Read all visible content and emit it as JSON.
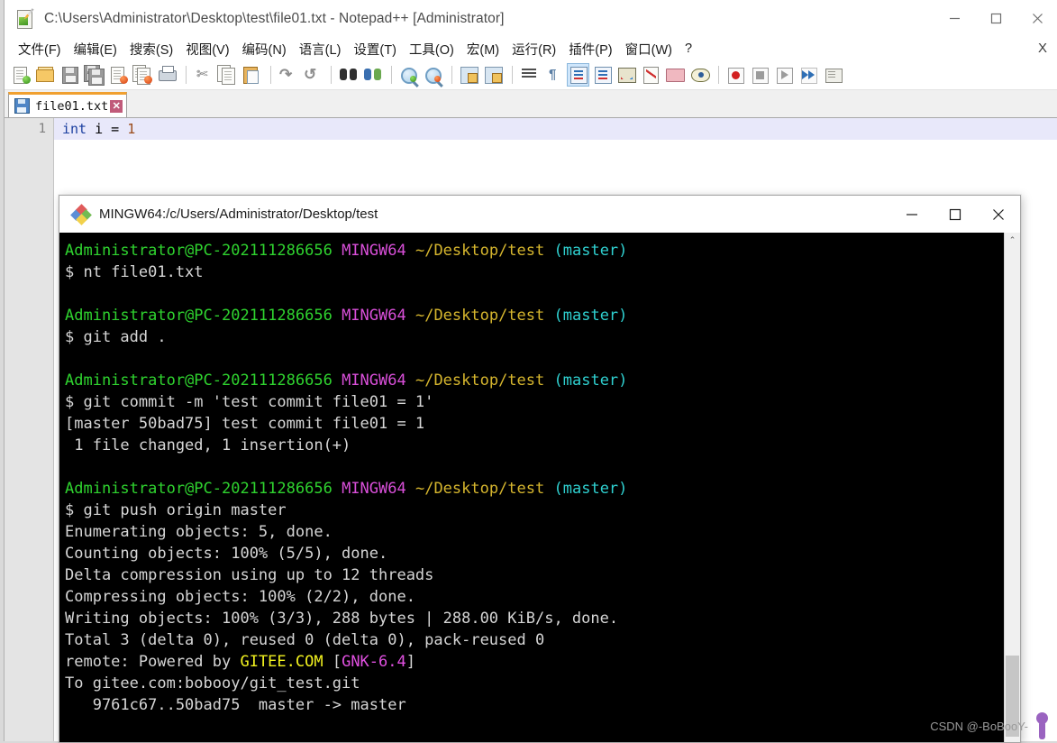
{
  "notepad": {
    "title": "C:\\Users\\Administrator\\Desktop\\test\\file01.txt - Notepad++ [Administrator]",
    "app_icon": "notepad-plus-plus-icon",
    "window_controls": {
      "minimize": "—",
      "maximize": "□",
      "close": "✕"
    },
    "menu": [
      "文件(F)",
      "编辑(E)",
      "搜索(S)",
      "视图(V)",
      "编码(N)",
      "语言(L)",
      "设置(T)",
      "工具(O)",
      "宏(M)",
      "运行(R)",
      "插件(P)",
      "窗口(W)",
      "?"
    ],
    "menu_close_label": "X",
    "toolbar": [
      {
        "name": "new-file-icon",
        "kind": "doc-new"
      },
      {
        "name": "open-file-icon",
        "kind": "folder-open"
      },
      {
        "name": "save-icon",
        "kind": "floppy"
      },
      {
        "name": "save-all-icon",
        "kind": "floppy-multi"
      },
      {
        "name": "close-file-icon",
        "kind": "doc-close"
      },
      {
        "name": "close-all-files-icon",
        "kind": "doc-multi-close"
      },
      {
        "name": "print-icon",
        "kind": "printer"
      },
      {
        "name": "separator",
        "kind": "sep"
      },
      {
        "name": "cut-icon",
        "kind": "scissors"
      },
      {
        "name": "copy-icon",
        "kind": "copy"
      },
      {
        "name": "paste-icon",
        "kind": "clipboard"
      },
      {
        "name": "separator",
        "kind": "sep"
      },
      {
        "name": "undo-icon",
        "kind": "undo"
      },
      {
        "name": "redo-icon",
        "kind": "redo"
      },
      {
        "name": "separator",
        "kind": "sep"
      },
      {
        "name": "find-icon",
        "kind": "binoculars"
      },
      {
        "name": "replace-icon",
        "kind": "replace"
      },
      {
        "name": "separator",
        "kind": "sep"
      },
      {
        "name": "zoom-in-icon",
        "kind": "magnifier-plus"
      },
      {
        "name": "zoom-out-icon",
        "kind": "magnifier-minus"
      },
      {
        "name": "separator",
        "kind": "sep"
      },
      {
        "name": "sync-vertical-scroll-icon",
        "kind": "lock-window"
      },
      {
        "name": "sync-horizontal-scroll-icon",
        "kind": "lock-window"
      },
      {
        "name": "separator",
        "kind": "sep"
      },
      {
        "name": "word-wrap-icon",
        "kind": "bars"
      },
      {
        "name": "show-all-characters-icon",
        "kind": "pilcrow"
      },
      {
        "name": "indent-guide-icon",
        "kind": "indent-guide",
        "selected": true
      },
      {
        "name": "user-defined-language-icon",
        "kind": "udl"
      },
      {
        "name": "document-map-icon",
        "kind": "map"
      },
      {
        "name": "function-list-icon",
        "kind": "function-list"
      },
      {
        "name": "folder-as-workspace-icon",
        "kind": "folder-pink"
      },
      {
        "name": "monitoring-icon",
        "kind": "eye"
      },
      {
        "name": "separator",
        "kind": "sep"
      },
      {
        "name": "start-record-macro-icon",
        "kind": "record"
      },
      {
        "name": "stop-record-macro-icon",
        "kind": "stop"
      },
      {
        "name": "playback-macro-icon",
        "kind": "play"
      },
      {
        "name": "run-macro-multiple-icon",
        "kind": "fast-forward"
      },
      {
        "name": "save-macro-icon",
        "kind": "save-macro"
      }
    ],
    "tab": {
      "label": "file01.txt",
      "icon": "saved-file-icon",
      "close_label": "✕"
    },
    "editor": {
      "line_number": "1",
      "code_parts": [
        {
          "text": "int",
          "cls": "kw"
        },
        {
          "text": " i = ",
          "cls": ""
        },
        {
          "text": "1",
          "cls": "num"
        }
      ]
    }
  },
  "terminal": {
    "title": "MINGW64:/c/Users/Administrator/Desktop/test",
    "icon": "git-bash-icon",
    "window_controls": {
      "minimize": "—",
      "maximize": "□",
      "close": "✕"
    },
    "scrollbar": {
      "up_arrow": "⌃"
    },
    "lines": [
      {
        "segs": [
          {
            "t": "Administrator@PC-202111286656",
            "c": "t-user"
          },
          {
            "t": " ",
            "c": "t-white"
          },
          {
            "t": "MINGW64",
            "c": "t-host"
          },
          {
            "t": " ",
            "c": "t-white"
          },
          {
            "t": "~/Desktop/test",
            "c": "t-path"
          },
          {
            "t": " ",
            "c": "t-white"
          },
          {
            "t": "(master)",
            "c": "t-branch"
          }
        ]
      },
      {
        "segs": [
          {
            "t": "$ nt file01.txt",
            "c": "t-white"
          }
        ]
      },
      {
        "segs": [
          {
            "t": "",
            "c": "t-white"
          }
        ]
      },
      {
        "segs": [
          {
            "t": "Administrator@PC-202111286656",
            "c": "t-user"
          },
          {
            "t": " ",
            "c": "t-white"
          },
          {
            "t": "MINGW64",
            "c": "t-host"
          },
          {
            "t": " ",
            "c": "t-white"
          },
          {
            "t": "~/Desktop/test",
            "c": "t-path"
          },
          {
            "t": " ",
            "c": "t-white"
          },
          {
            "t": "(master)",
            "c": "t-branch"
          }
        ]
      },
      {
        "segs": [
          {
            "t": "$ git add .",
            "c": "t-white"
          }
        ]
      },
      {
        "segs": [
          {
            "t": "",
            "c": "t-white"
          }
        ]
      },
      {
        "segs": [
          {
            "t": "Administrator@PC-202111286656",
            "c": "t-user"
          },
          {
            "t": " ",
            "c": "t-white"
          },
          {
            "t": "MINGW64",
            "c": "t-host"
          },
          {
            "t": " ",
            "c": "t-white"
          },
          {
            "t": "~/Desktop/test",
            "c": "t-path"
          },
          {
            "t": " ",
            "c": "t-white"
          },
          {
            "t": "(master)",
            "c": "t-branch"
          }
        ]
      },
      {
        "segs": [
          {
            "t": "$ git commit -m 'test commit file01 = 1'",
            "c": "t-white"
          }
        ]
      },
      {
        "segs": [
          {
            "t": "[master 50bad75] test commit file01 = 1",
            "c": "t-white"
          }
        ]
      },
      {
        "segs": [
          {
            "t": " 1 file changed, 1 insertion(+)",
            "c": "t-white"
          }
        ]
      },
      {
        "segs": [
          {
            "t": "",
            "c": "t-white"
          }
        ]
      },
      {
        "segs": [
          {
            "t": "Administrator@PC-202111286656",
            "c": "t-user"
          },
          {
            "t": " ",
            "c": "t-white"
          },
          {
            "t": "MINGW64",
            "c": "t-host"
          },
          {
            "t": " ",
            "c": "t-white"
          },
          {
            "t": "~/Desktop/test",
            "c": "t-path"
          },
          {
            "t": " ",
            "c": "t-white"
          },
          {
            "t": "(master)",
            "c": "t-branch"
          }
        ]
      },
      {
        "segs": [
          {
            "t": "$ git push origin master",
            "c": "t-white"
          }
        ]
      },
      {
        "segs": [
          {
            "t": "Enumerating objects: 5, done.",
            "c": "t-white"
          }
        ]
      },
      {
        "segs": [
          {
            "t": "Counting objects: 100% (5/5), done.",
            "c": "t-white"
          }
        ]
      },
      {
        "segs": [
          {
            "t": "Delta compression using up to 12 threads",
            "c": "t-white"
          }
        ]
      },
      {
        "segs": [
          {
            "t": "Compressing objects: 100% (2/2), done.",
            "c": "t-white"
          }
        ]
      },
      {
        "segs": [
          {
            "t": "Writing objects: 100% (3/3), 288 bytes | 288.00 KiB/s, done.",
            "c": "t-white"
          }
        ]
      },
      {
        "segs": [
          {
            "t": "Total 3 (delta 0), reused 0 (delta 0), pack-reused 0",
            "c": "t-white"
          }
        ]
      },
      {
        "segs": [
          {
            "t": "remote: Powered by ",
            "c": "t-white"
          },
          {
            "t": "GITEE.COM",
            "c": "t-yellow"
          },
          {
            "t": " [",
            "c": "t-white"
          },
          {
            "t": "GNK-6.4",
            "c": "t-magenta"
          },
          {
            "t": "]",
            "c": "t-white"
          }
        ]
      },
      {
        "segs": [
          {
            "t": "To gitee.com:bobooy/git_test.git",
            "c": "t-white"
          }
        ]
      },
      {
        "segs": [
          {
            "t": "   9761c67..50bad75  master -> master",
            "c": "t-white"
          }
        ]
      }
    ]
  },
  "watermark": {
    "text": "CSDN @-BoBooY-",
    "logo": "csdn-logo-icon"
  },
  "colors": {
    "terminal_bg": "#000000",
    "prompt_user": "#2fd32f",
    "prompt_host": "#d94fd9",
    "prompt_path": "#d6b62e",
    "prompt_branch": "#2fd0d0",
    "gitee_yellow": "#f2f21f",
    "gnk_magenta": "#e050e0",
    "tab_active_top": "#f0a030",
    "current_line": "#e8e8fa"
  }
}
